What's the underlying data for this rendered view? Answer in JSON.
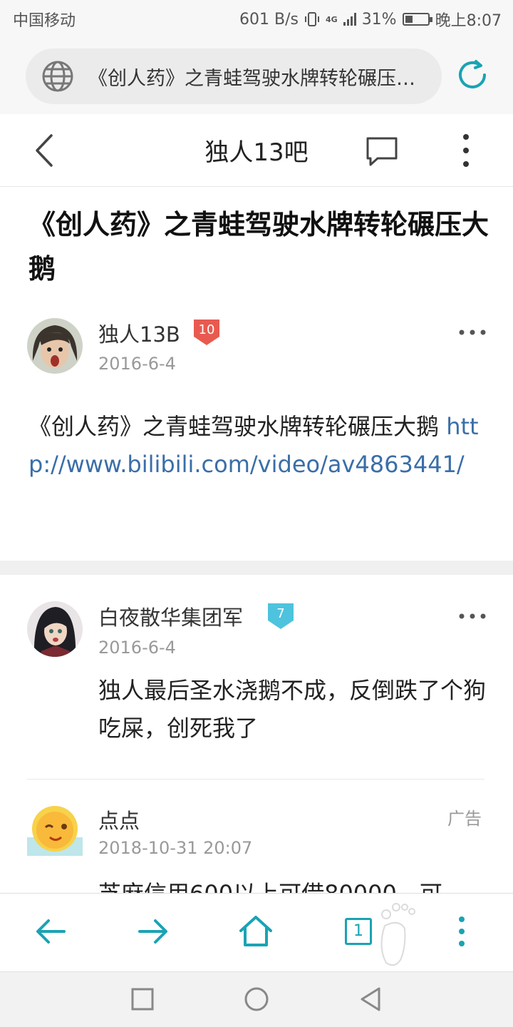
{
  "status_bar": {
    "carrier": "中国移动",
    "net_speed": "601 B/s",
    "network_type": "4G",
    "battery": "31%",
    "battery_level": 0.31,
    "time": "晚上8:07"
  },
  "browser": {
    "url_title": "《创人药》之青蛙驾驶水牌转轮碾压大鹅",
    "accent_color": "#1aa3b4"
  },
  "header": {
    "forum_title": "独人13吧"
  },
  "post": {
    "title": "《创人药》之青蛙驾驶水牌转轮碾压大鹅",
    "author": "独人13B",
    "level": "10",
    "date": "2016-6-4",
    "body_text": "《创人药》之青蛙驾驶水牌转轮碾压大鹅 ",
    "link": "http://www.bilibili.com/video/av4863441/"
  },
  "reply": {
    "author": "白夜散华集团军",
    "level": "7",
    "date": "2016-6-4",
    "text": "独人最后圣水浇鹅不成，反倒跌了个狗吃屎，创死我了"
  },
  "ad": {
    "author": "点点",
    "date": "2018-10-31 20:07",
    "label": "广告",
    "text": "芝麻信用600以上可借80000，可"
  },
  "toolbar": {
    "tab_count": "1"
  }
}
